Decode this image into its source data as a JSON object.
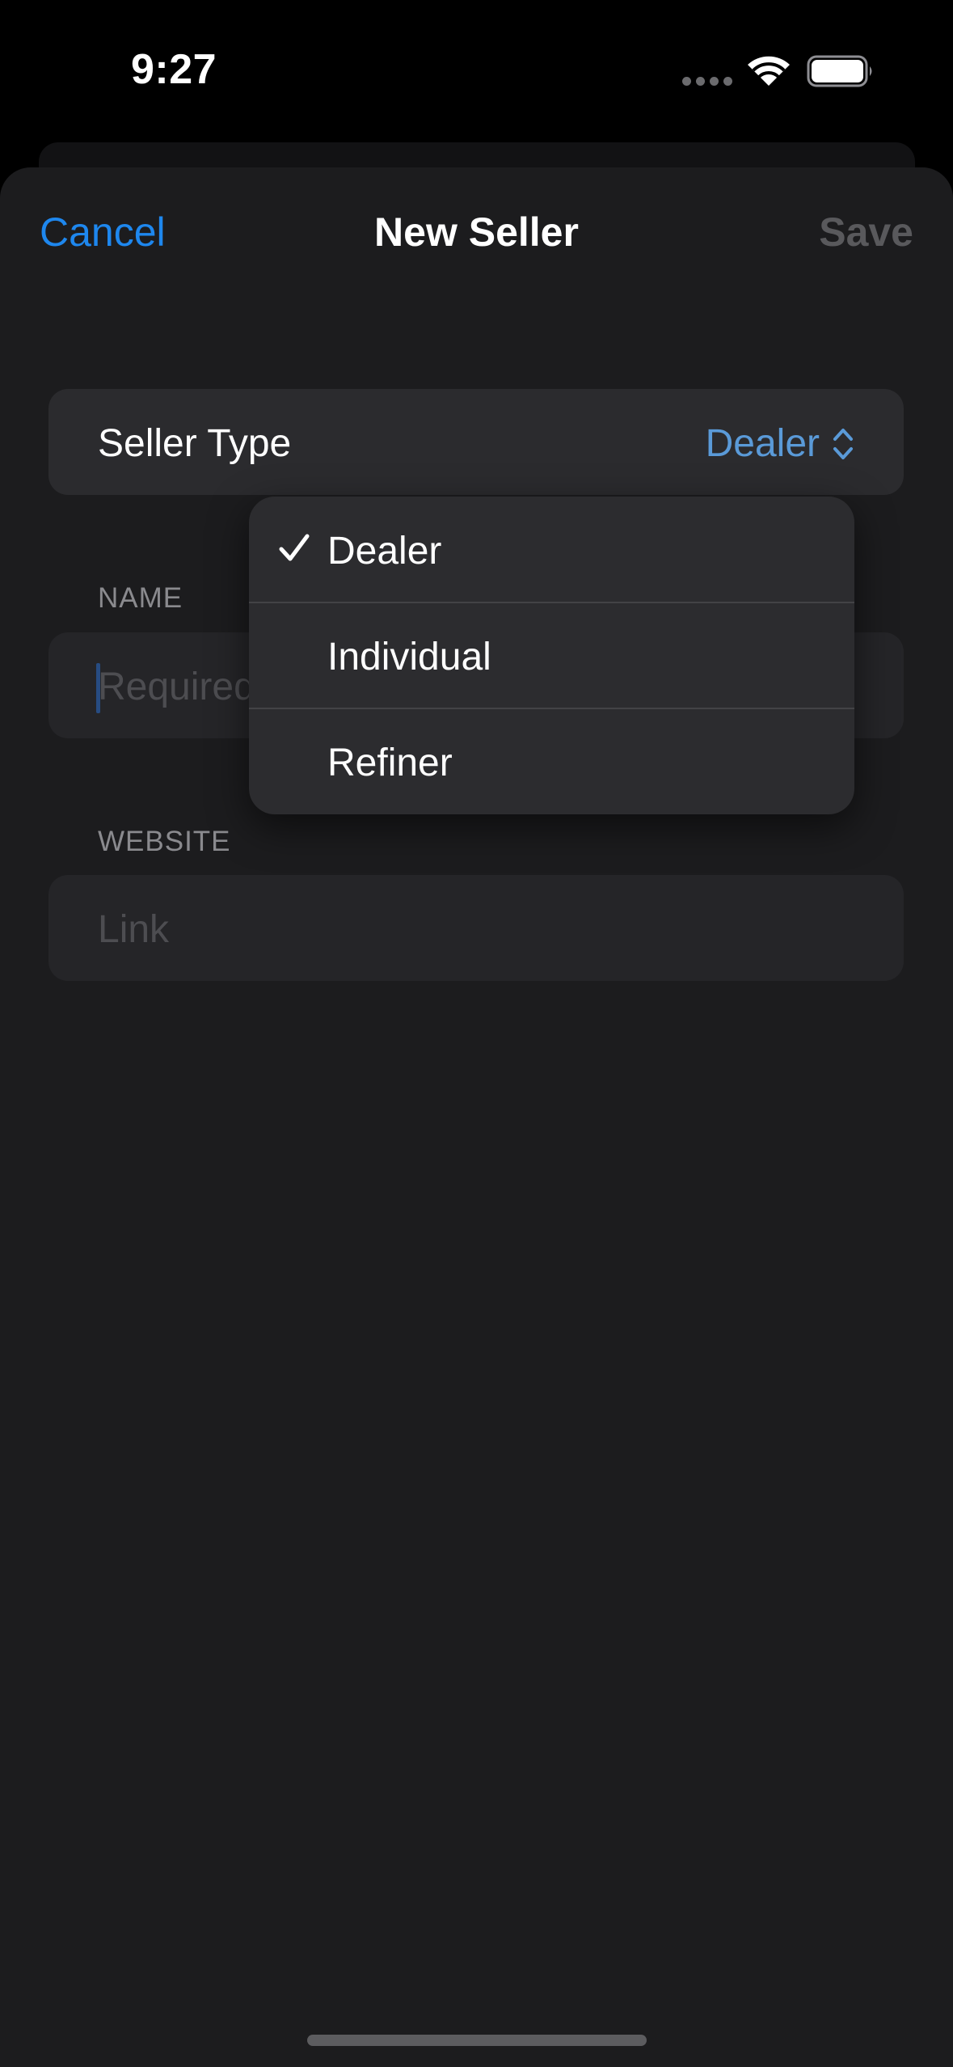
{
  "status_bar": {
    "time": "9:27"
  },
  "nav": {
    "cancel_label": "Cancel",
    "title": "New Seller",
    "save_label": "Save"
  },
  "seller_type": {
    "label": "Seller Type",
    "value": "Dealer"
  },
  "name_section": {
    "label": "NAME",
    "placeholder": "Required"
  },
  "website_section": {
    "label": "WEBSITE",
    "placeholder": "Link"
  },
  "menu": {
    "items": [
      {
        "label": "Dealer",
        "selected": true
      },
      {
        "label": "Individual",
        "selected": false
      },
      {
        "label": "Refiner",
        "selected": false
      }
    ]
  },
  "colors": {
    "accent": "#1e87ee",
    "picker_value": "#5a9ad8",
    "background": "#1c1c1e"
  },
  "icons": {
    "wifi": "wifi-icon",
    "battery": "battery-icon",
    "checkmark": "checkmark-icon",
    "picker_chevron": "chevron-up-down-icon"
  }
}
